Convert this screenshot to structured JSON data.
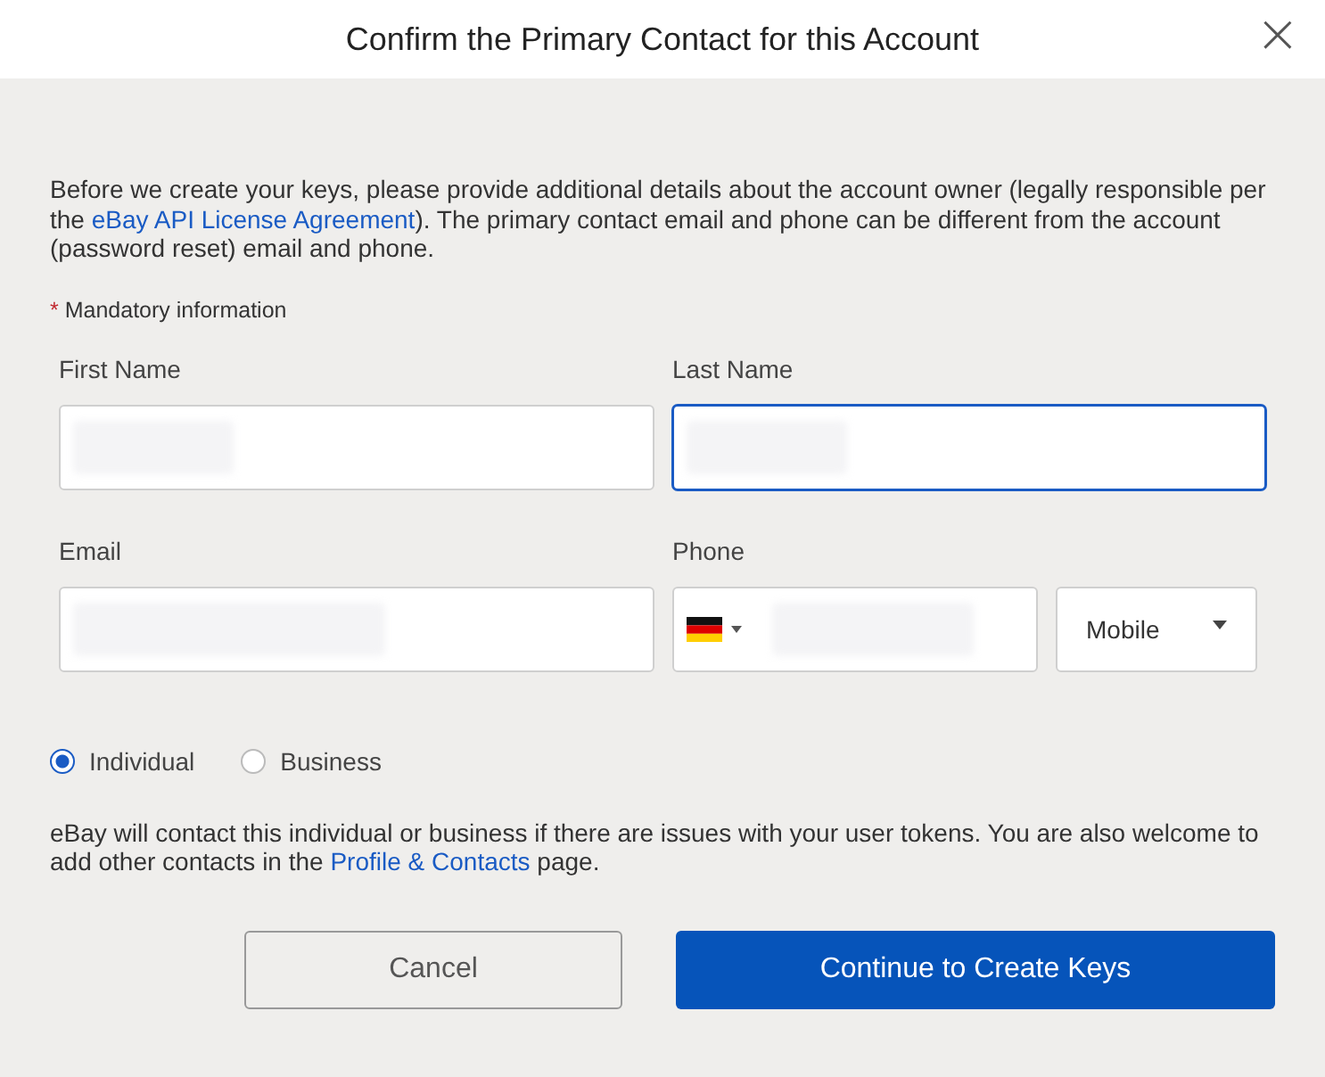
{
  "dialog": {
    "title": "Confirm the Primary Contact for this Account",
    "close": "×"
  },
  "intro": {
    "before": "Before we create your keys, please provide additional details about the account owner (legally responsible per the ",
    "link": "eBay API License Agreement",
    "after": "). The primary contact email and phone can be different from the account (password reset) email and phone."
  },
  "mandatory": {
    "mark": "*",
    "text": "Mandatory information"
  },
  "fields": [
    {
      "label": "First Name",
      "kind": "text",
      "value_hidden": true,
      "focused": false
    },
    {
      "label": "Last Name",
      "kind": "text",
      "value_hidden": true,
      "focused": true
    },
    {
      "label": "Email",
      "kind": "text",
      "value_hidden": true,
      "focused": false
    },
    {
      "label": "Phone",
      "kind": "phone",
      "value_hidden": true,
      "focused": false,
      "phone_type": "Mobile"
    }
  ],
  "contact_types": [
    {
      "label": "Individual",
      "selected": true
    },
    {
      "label": "Business",
      "selected": false
    }
  ],
  "note": {
    "before": "eBay will contact this individual or business if there are issues with your user tokens. You are also welcome to add other contacts in the ",
    "link": "Profile & Contacts",
    "after": " page."
  },
  "buttons": {
    "cancel": "Cancel",
    "confirm": "Continue to Create Keys"
  }
}
